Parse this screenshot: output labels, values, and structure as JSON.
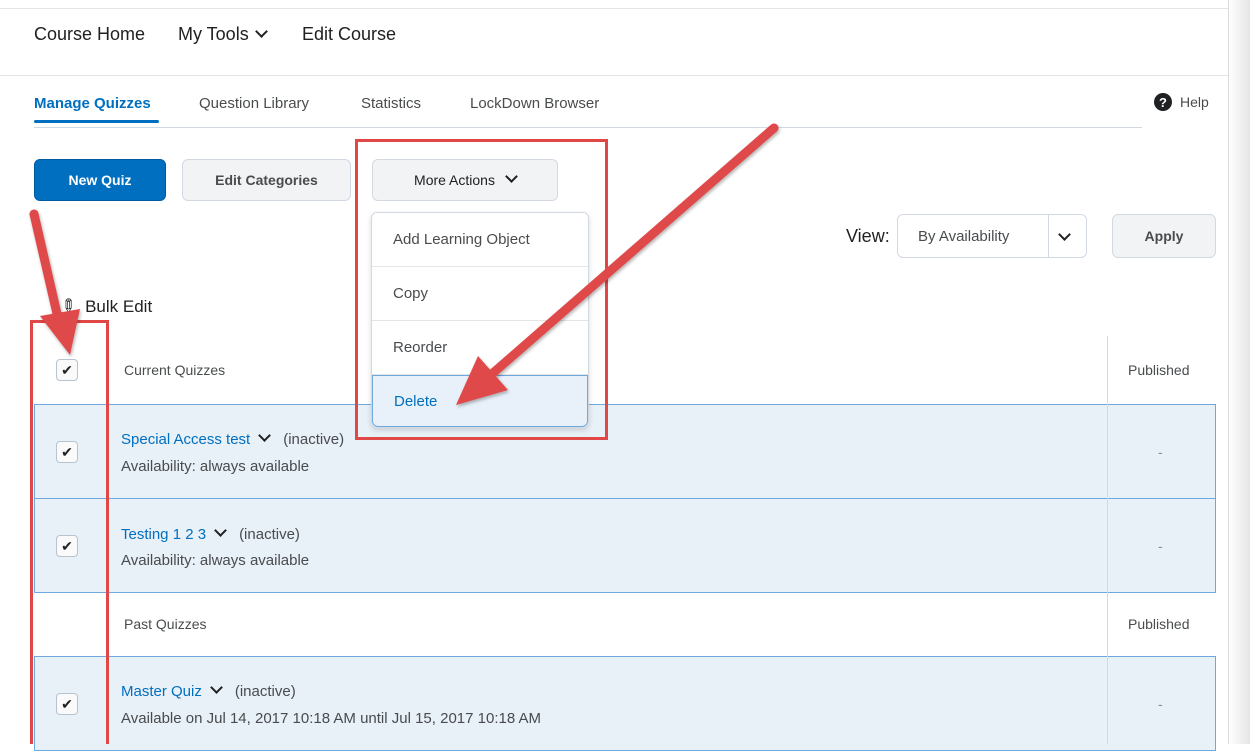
{
  "nav": {
    "course_home": "Course Home",
    "my_tools": "My Tools",
    "edit_course": "Edit Course"
  },
  "tabs": [
    {
      "label": "Manage Quizzes",
      "active": true
    },
    {
      "label": "Question Library",
      "active": false
    },
    {
      "label": "Statistics",
      "active": false
    },
    {
      "label": "LockDown Browser",
      "active": false
    }
  ],
  "help": {
    "icon": "question-circle-icon",
    "label": "Help"
  },
  "toolbar": {
    "new_quiz": "New Quiz",
    "edit_categories": "Edit Categories",
    "more_actions": "More Actions"
  },
  "more_actions_menu": {
    "items": [
      "Add Learning Object",
      "Copy",
      "Reorder",
      "Delete"
    ],
    "highlighted": "Delete"
  },
  "view": {
    "label": "View:",
    "selected": "By Availability",
    "apply": "Apply"
  },
  "bulk_edit": {
    "icon": "pencil-icon",
    "label": "Bulk Edit"
  },
  "table": {
    "sections": [
      {
        "header": "Current Quizzes",
        "published_header": "Published",
        "quizzes": [
          {
            "title": "Special Access test",
            "status": "(inactive)",
            "availability": "Availability: always available",
            "published": "-",
            "checked": true
          },
          {
            "title": "Testing 1 2 3",
            "status": "(inactive)",
            "availability": "Availability: always available",
            "published": "-",
            "checked": true
          }
        ]
      },
      {
        "header": "Past Quizzes",
        "published_header": "Published",
        "quizzes": [
          {
            "title": "Master Quiz",
            "status": "(inactive)",
            "availability": "Available on Jul 14, 2017 10:18 AM until Jul 15, 2017 10:18 AM",
            "published": "-",
            "checked": true
          }
        ]
      }
    ],
    "select_all_checked": true
  },
  "colors": {
    "primary": "#006fbf",
    "annotation_red": "#e04848",
    "selected_row": "#e8f0f8"
  }
}
